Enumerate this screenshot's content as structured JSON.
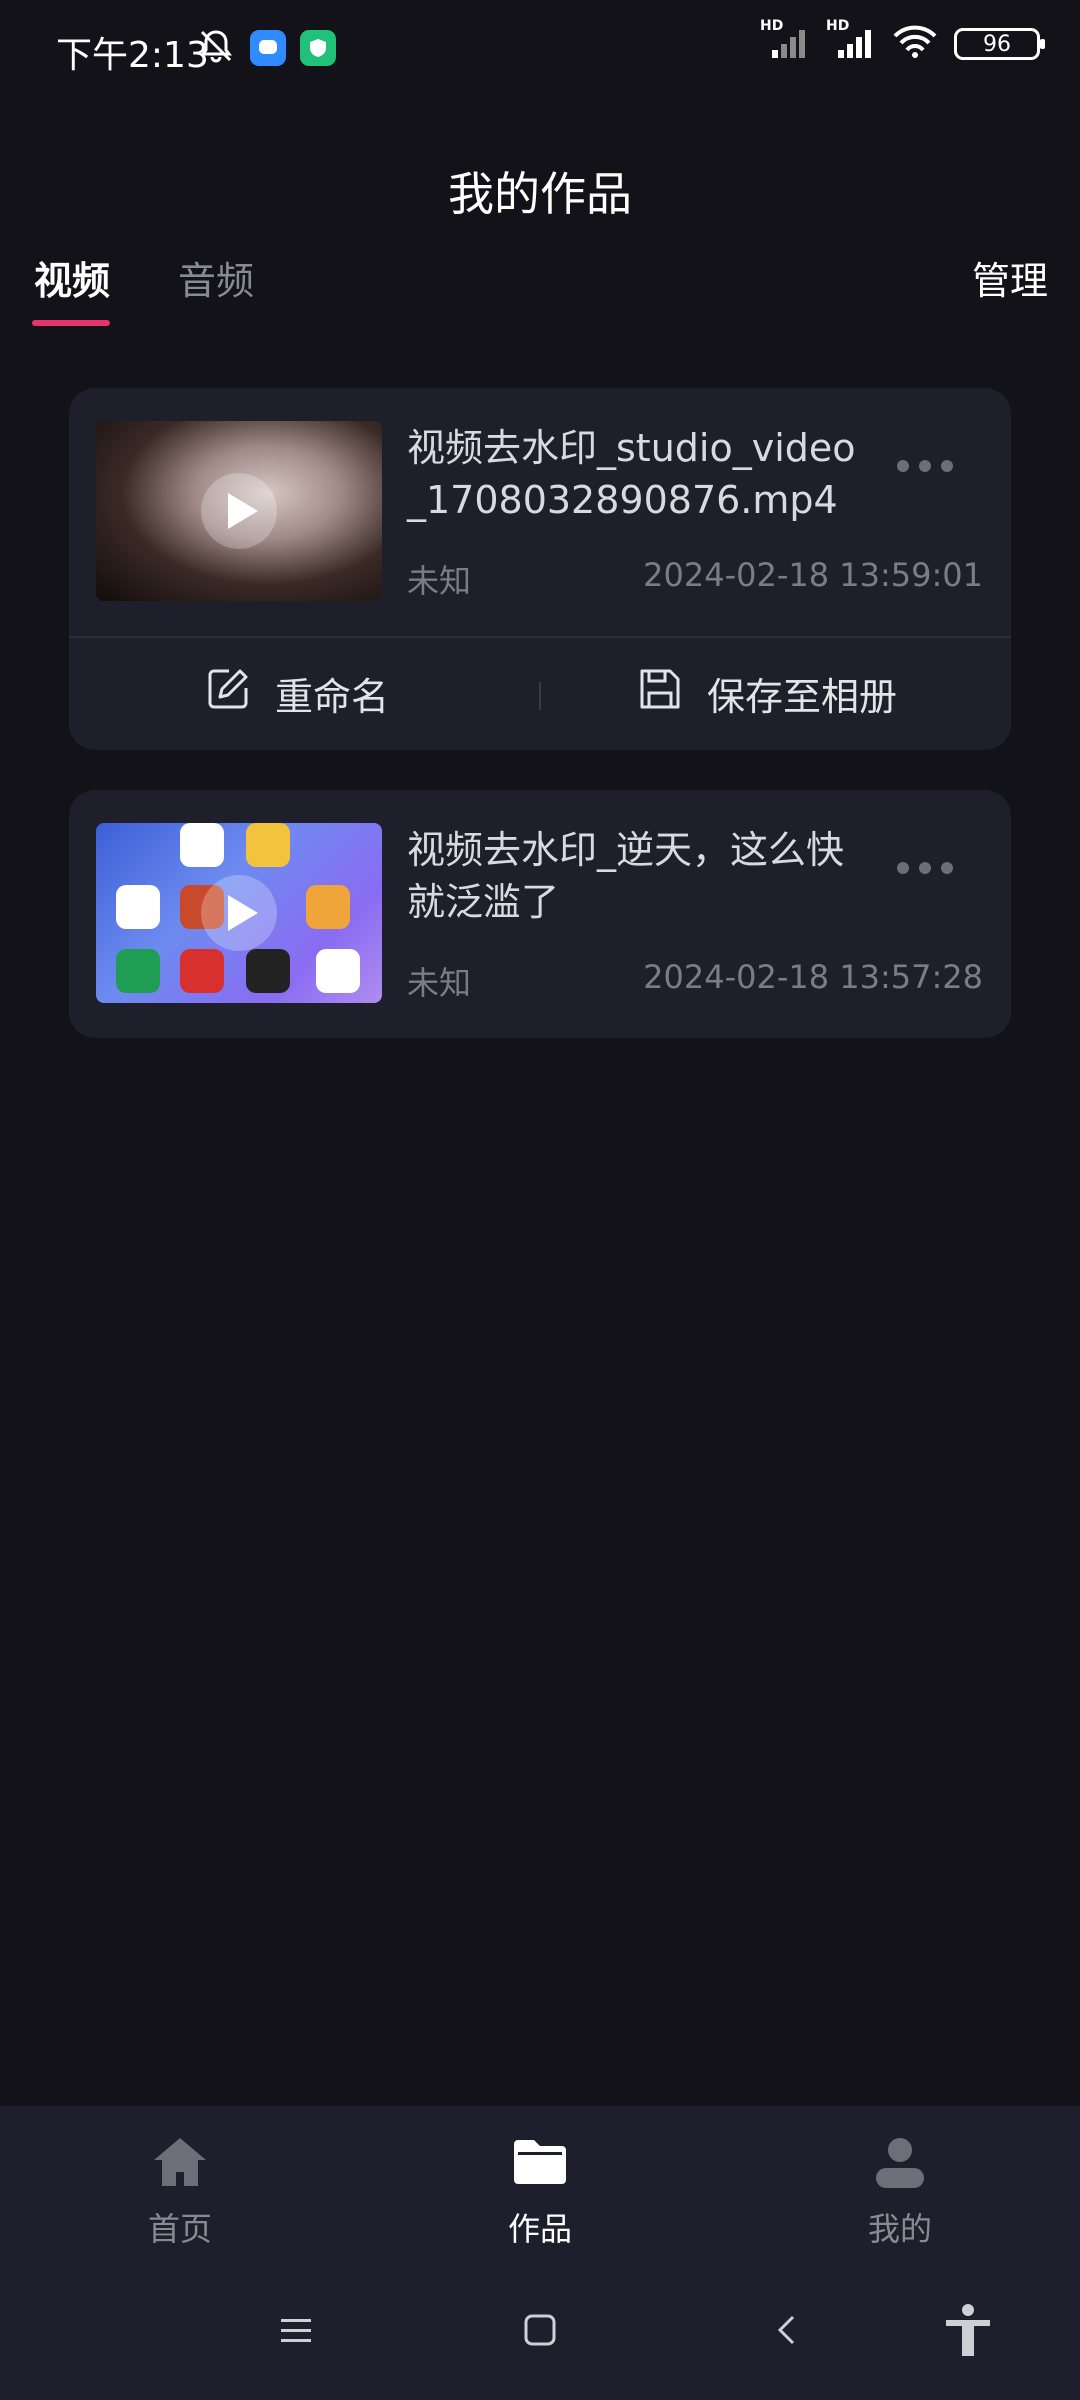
{
  "status_bar": {
    "time": "下午2:13",
    "battery": "96",
    "signal_label_1": "HD",
    "signal_label_2": "HD"
  },
  "header": {
    "title": "我的作品",
    "tabs": [
      {
        "label": "视频",
        "active": true
      },
      {
        "label": "音频",
        "active": false
      }
    ],
    "manage_label": "管理",
    "accent_color": "#e7336c"
  },
  "works": [
    {
      "title": "视频去水印_studio_video_1708032890876.mp4",
      "status": "未知",
      "datetime": "2024-02-18 13:59:01",
      "actions": {
        "rename": "重命名",
        "save": "保存至相册"
      }
    },
    {
      "title": "视频去水印_逆天，这么快就泛滥了",
      "status": "未知",
      "datetime": "2024-02-18 13:57:28"
    }
  ],
  "bottom_nav": {
    "items": [
      {
        "label": "首页",
        "icon": "home-icon",
        "active": false
      },
      {
        "label": "作品",
        "icon": "folder-icon",
        "active": true
      },
      {
        "label": "我的",
        "icon": "user-icon",
        "active": false
      }
    ]
  }
}
